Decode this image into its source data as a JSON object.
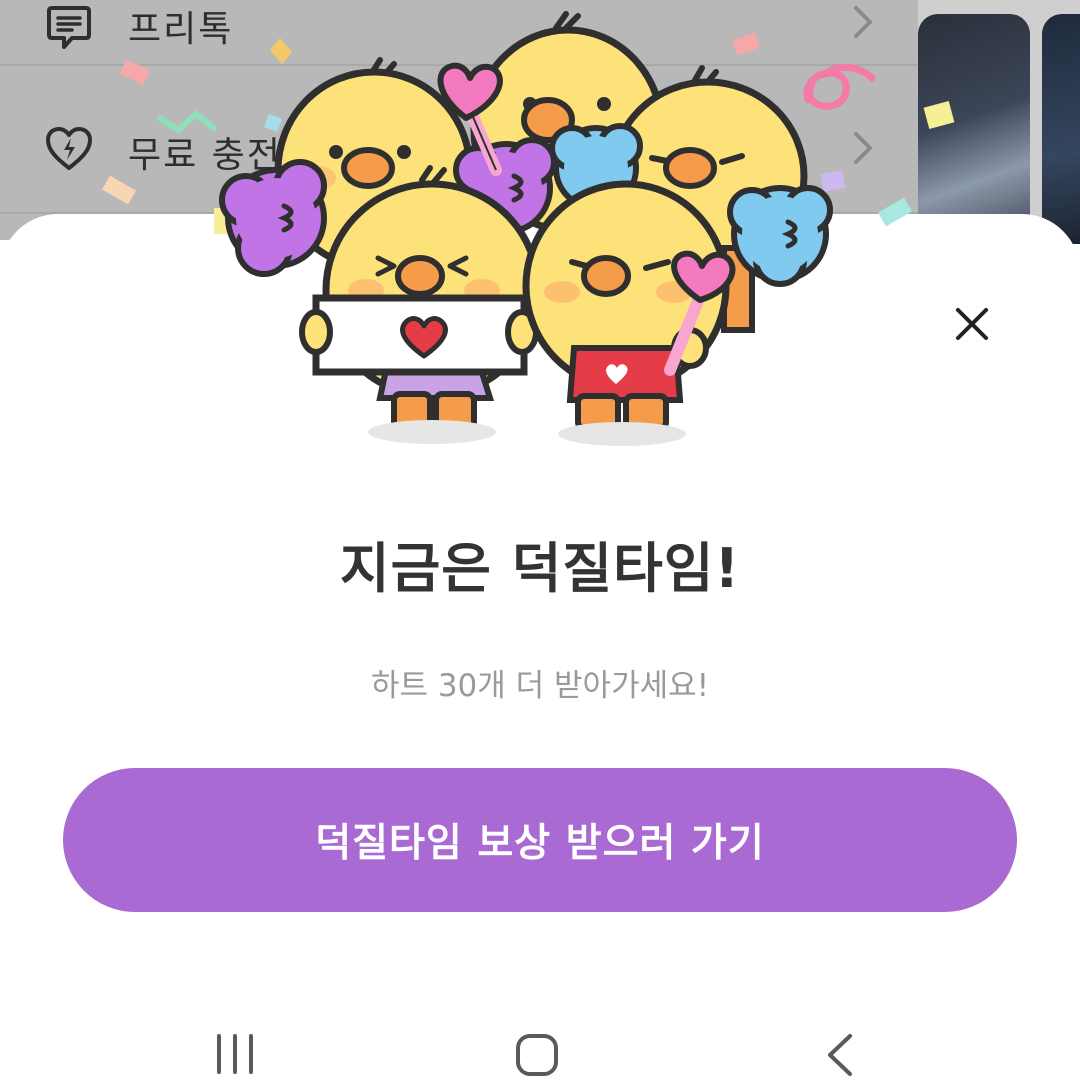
{
  "background_menu": {
    "items": [
      {
        "label": "프리톡",
        "icon": "chat-bubble-icon"
      },
      {
        "label": "무료 충전",
        "icon": "heart-lightning-icon"
      }
    ]
  },
  "popup": {
    "title": "지금은 덕질타임!",
    "subtitle": "하트 30개 더 받아가세요!",
    "cta_label": "덕질타임 보상 받으러 가기",
    "close_icon": "close-icon",
    "illustration": "cheering-chicks-illustration"
  },
  "navbar": {
    "recents_icon": "recent-apps-icon",
    "home_icon": "home-icon",
    "back_icon": "back-icon"
  },
  "colors": {
    "accent": "#a96ad3",
    "title": "#333333",
    "subtitle": "#9a9a9a",
    "overlay": "#b8b8b8"
  }
}
